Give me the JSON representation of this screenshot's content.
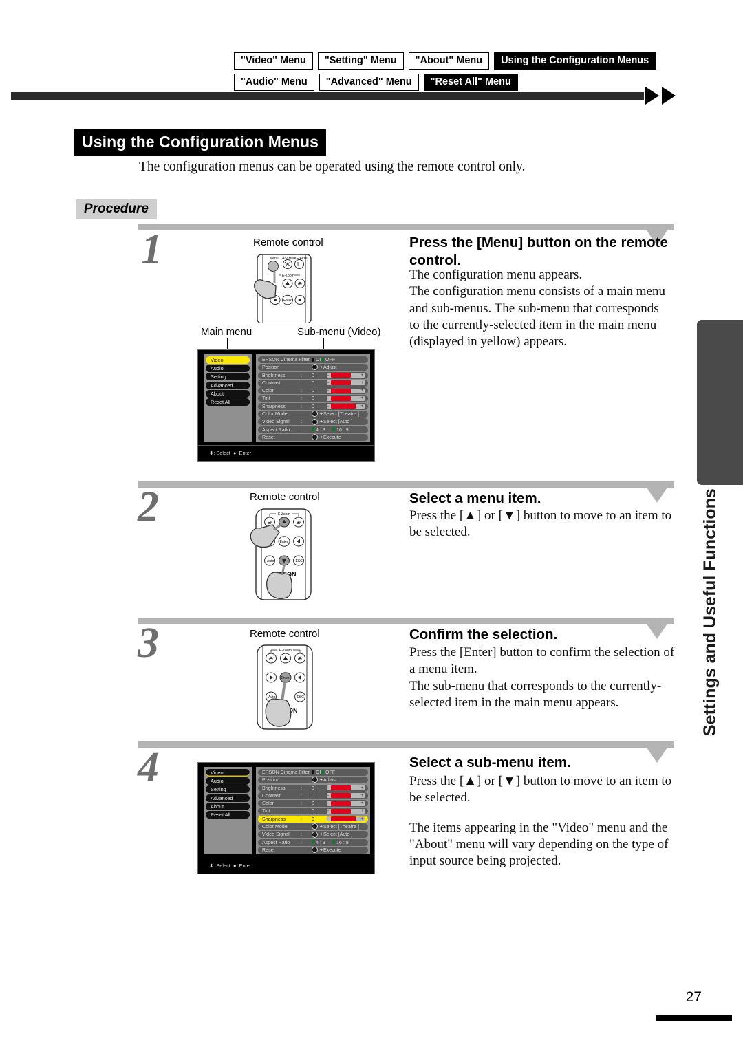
{
  "header": {
    "tabs_row1": [
      {
        "label": "\"Video\" Menu",
        "active": false
      },
      {
        "label": "\"Setting\" Menu",
        "active": false
      },
      {
        "label": "\"About\" Menu",
        "active": false
      },
      {
        "label": "Using the Configuration Menus",
        "active": true
      }
    ],
    "tabs_row2": [
      {
        "label": "\"Audio\" Menu",
        "active": false
      },
      {
        "label": "\"Advanced\" Menu",
        "active": false
      },
      {
        "label": "\"Reset All\" Menu",
        "active": true
      }
    ]
  },
  "page": {
    "title": "Using the Configuration Menus",
    "intro": "The configuration menus can be operated using the remote control only.",
    "procedure_label": "Procedure",
    "side_tab_text": "Settings and Useful Functions",
    "page_number": "27"
  },
  "steps": [
    {
      "number": "1",
      "remote_caption": "Remote control",
      "heading": "Press the [Menu] button on the remote control.",
      "body": [
        "The configuration menu appears.",
        "The configuration menu consists of a main menu and sub-menus. The sub-menu that corresponds to the currently-selected item in the main menu (displayed in yellow) appears."
      ]
    },
    {
      "number": "2",
      "remote_caption": "Remote control",
      "heading": "Select a menu item.",
      "body": [
        "Press the [▲] or [▼] button to move to an item to be selected."
      ]
    },
    {
      "number": "3",
      "remote_caption": "Remote control",
      "heading": "Confirm the selection.",
      "body": [
        "Press the [Enter] button to confirm the selection of a menu item.",
        "The sub-menu that corresponds to the currently-selected item in the main menu appears."
      ]
    },
    {
      "number": "4",
      "remote_caption": "",
      "heading": "Select a sub-menu item.",
      "body": [
        "Press the [▲] or [▼] button to move to an item to be selected.",
        "The items appearing in the \"Video\" menu and the \"About\" menu will vary depending on the type of input source being projected."
      ]
    }
  ],
  "remote_buttons": {
    "menu": "Menu",
    "av_mute": "A/V Mute",
    "freeze": "Freeze",
    "ezoom": "E-Zoom",
    "enter": "Enter",
    "auto": "Auto",
    "esc": "ESC",
    "brand": "EPSON"
  },
  "menu_shot": {
    "callout_main": "Main menu",
    "callout_sub": "Sub-menu (Video)",
    "main_menu": [
      {
        "label": "Video"
      },
      {
        "label": "Audio"
      },
      {
        "label": "Setting"
      },
      {
        "label": "Advanced"
      },
      {
        "label": "About"
      },
      {
        "label": "Reset All"
      }
    ],
    "sub_menu": [
      {
        "label": "EPSON Cinema Filter",
        "colon": ":",
        "type": "radio",
        "options": [
          {
            "text": "ON",
            "on": false
          },
          {
            "text": "OFF",
            "on": true
          }
        ]
      },
      {
        "label": "Position",
        "colon": "",
        "type": "action",
        "action": "Adjust"
      },
      {
        "label": "Brightness",
        "colon": ":",
        "type": "slider",
        "value": "0",
        "fill": 44,
        "minus": "-",
        "plus": "+"
      },
      {
        "label": "Contrast",
        "colon": ":",
        "type": "slider",
        "value": "0",
        "fill": 44,
        "minus": "-",
        "plus": "+"
      },
      {
        "label": "Color",
        "colon": ":",
        "type": "slider",
        "value": "0",
        "fill": 44,
        "minus": "-",
        "plus": "+"
      },
      {
        "label": "Tint",
        "colon": ":",
        "type": "slider",
        "value": "0",
        "fill": 44,
        "minus": "-",
        "plus": "+"
      },
      {
        "label": "Sharpness",
        "colon": ":",
        "type": "slider",
        "value": "0",
        "fill": 60,
        "minus": "-",
        "plus": "+"
      },
      {
        "label": "Color Mode",
        "colon": "",
        "type": "select",
        "action": "Select",
        "selected": "[Theatre         ]"
      },
      {
        "label": "Video Signal",
        "colon": ":",
        "type": "select",
        "action": "Select",
        "selected": "[Auto        ]"
      },
      {
        "label": "Aspect Ratio",
        "colon": ":",
        "type": "radio",
        "options": [
          {
            "text": "4 : 3",
            "on": true
          },
          {
            "text": "16 : 9",
            "on": true
          }
        ]
      },
      {
        "label": "Reset",
        "colon": "",
        "type": "action",
        "action": "Execute"
      }
    ],
    "footer_select": ": Select",
    "footer_enter": ": Enter",
    "highlight_step1": "Video",
    "highlight_step4": "Sharpness"
  },
  "colors": {
    "highlight_yellow": "#ffe800",
    "slider_red": "#e2001a",
    "radio_green": "#0b7a2a",
    "tab_gray": "#4a4a4a"
  }
}
